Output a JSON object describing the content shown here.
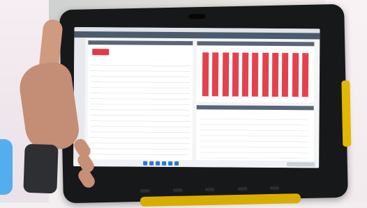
{
  "scene": {
    "colors": {
      "tablet_body": "#171819",
      "bumper": "#e2b800",
      "accent_red": "#e53843",
      "app_header": "#4b5b6e",
      "background": "#f3eef0"
    }
  },
  "screen": {
    "bar_chart": {
      "bar_count": 11,
      "bar_color": "#e5414d"
    },
    "icons": [
      "taskbar-app-icons",
      "tray-area-icon",
      "camera-icon"
    ]
  }
}
